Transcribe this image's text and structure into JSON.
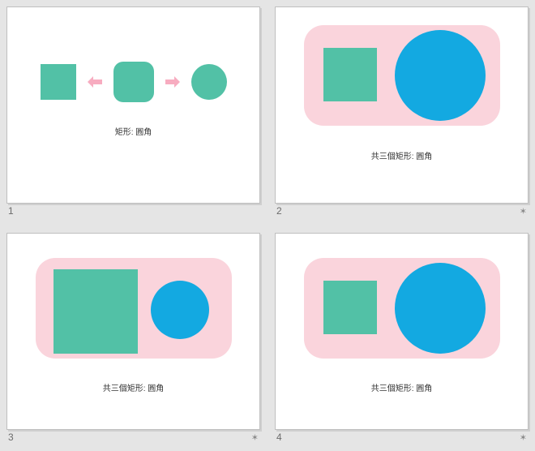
{
  "slides": [
    {
      "number": "1",
      "caption": "矩形: 圓角",
      "has_star": false
    },
    {
      "number": "2",
      "caption": "共三個矩形: 圓角",
      "has_star": true
    },
    {
      "number": "3",
      "caption": "共三個矩形: 圓角",
      "has_star": true
    },
    {
      "number": "4",
      "caption": "共三個矩形: 圓角",
      "has_star": true
    }
  ],
  "shapes": {
    "square_color": "#52c1a6",
    "circle_color": "#13a9e1",
    "pill_color": "#fad4dc",
    "arrow_color": "#f7acc0"
  },
  "star_glyph": "✶"
}
